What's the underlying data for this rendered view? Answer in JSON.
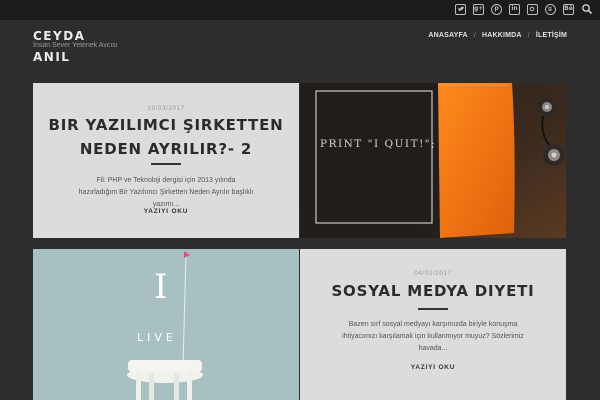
{
  "colors": {
    "page_background": "#2d2d2d",
    "topbar_background": "#1c1c1c",
    "card_background": "#dcdcdc",
    "heading_text": "#2b2b2b",
    "light_text": "#ececec"
  },
  "topbar": {
    "social_icons": [
      "twitter-icon",
      "google-plus-icon",
      "pinterest-icon",
      "linkedin-icon",
      "instagram-icon",
      "spotify-icon",
      "behance-icon"
    ],
    "search_icon": "search-icon"
  },
  "brand": {
    "first_name": "CEYDA",
    "tagline": "İnsan Sever Yetenek Avcısı",
    "last_name": "ANIL"
  },
  "nav": {
    "items": [
      "ANASAYFA",
      "HAKKIMDA",
      "İLETİŞİM"
    ],
    "separator": "/"
  },
  "posts": [
    {
      "date": "19/03/2017",
      "title_line1": "BIR YAZILIMCI ŞIRKETTEN",
      "title_line2": "NEDEN AYRILIR?- 2",
      "excerpt": "Fil: PHP ve Teknoloji dergisi için 2013 yılında hazırladığım Bir Yazılımcı Şirketten Neden Ayrılır başlıklı yazımı...",
      "more": "YAZIYI OKU"
    },
    {
      "date": "04/02/2017",
      "title_line1": "SOSYAL MEDYA DIYETI",
      "excerpt": "Bazen sırf sosyal medyayı karşımızda biriyle konuşma ihtiyacımızı karşılamak için kullanmıyor muyuz? Sözlerimiz havada...",
      "more": "YAZIYI OKU"
    }
  ],
  "images": {
    "print_quit_text": "PRINT \"I QUIT!\";",
    "i_live_big": "I",
    "i_live_word": "LIVE"
  }
}
